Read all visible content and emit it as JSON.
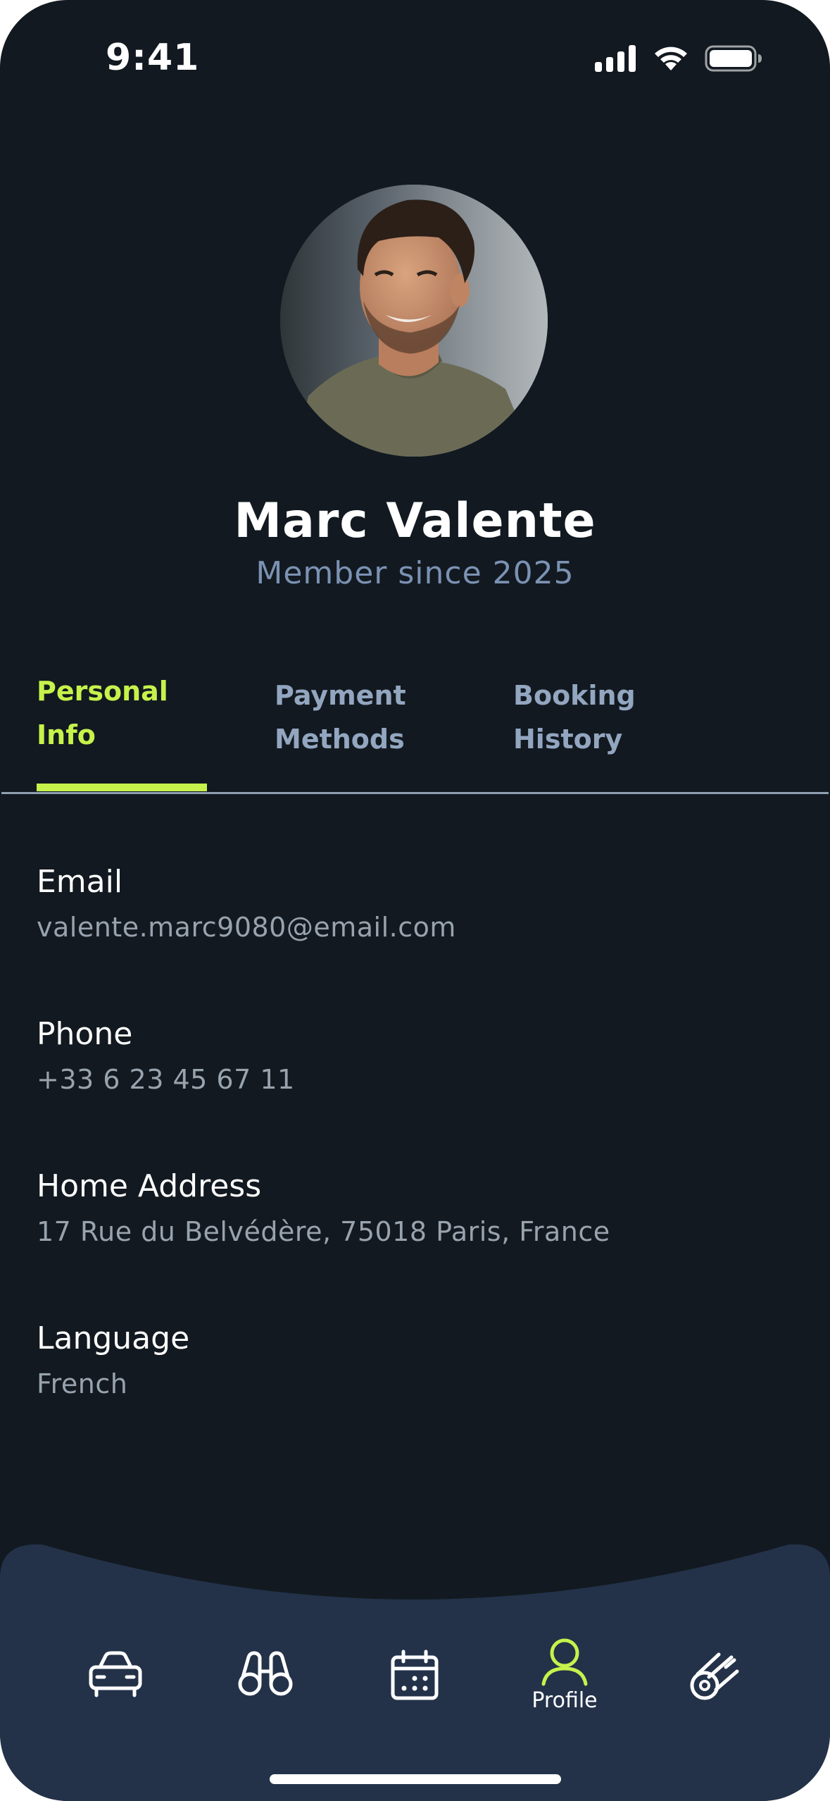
{
  "status_bar": {
    "time": "9:41"
  },
  "profile": {
    "name": "Marc Valente",
    "member_since": "Member since 2025"
  },
  "tabs": [
    {
      "label": "Personal\nInfo",
      "active": true
    },
    {
      "label": "Payment\nMethods",
      "active": false
    },
    {
      "label": "Booking\nHistory",
      "active": false
    }
  ],
  "fields": [
    {
      "label": "Email",
      "value": "valente.marc9080@email.com"
    },
    {
      "label": "Phone",
      "value": "+33 6 23 45 67 11"
    },
    {
      "label": "Home Address",
      "value": "17 Rue du Belvédère, 75018 Paris, France"
    },
    {
      "label": "Language",
      "value": "French"
    }
  ],
  "bottom_nav": {
    "items": [
      {
        "icon": "car-icon",
        "label": ""
      },
      {
        "icon": "binoculars-icon",
        "label": ""
      },
      {
        "icon": "calendar-icon",
        "label": ""
      },
      {
        "icon": "profile-icon",
        "label": "Profile",
        "active": true
      },
      {
        "icon": "comet-icon",
        "label": ""
      }
    ]
  },
  "colors": {
    "background": "#121920",
    "accent": "#c6f24b",
    "nav_background": "#233249",
    "muted_text": "#98a3ae",
    "tab_inactive": "#93a6c0"
  }
}
